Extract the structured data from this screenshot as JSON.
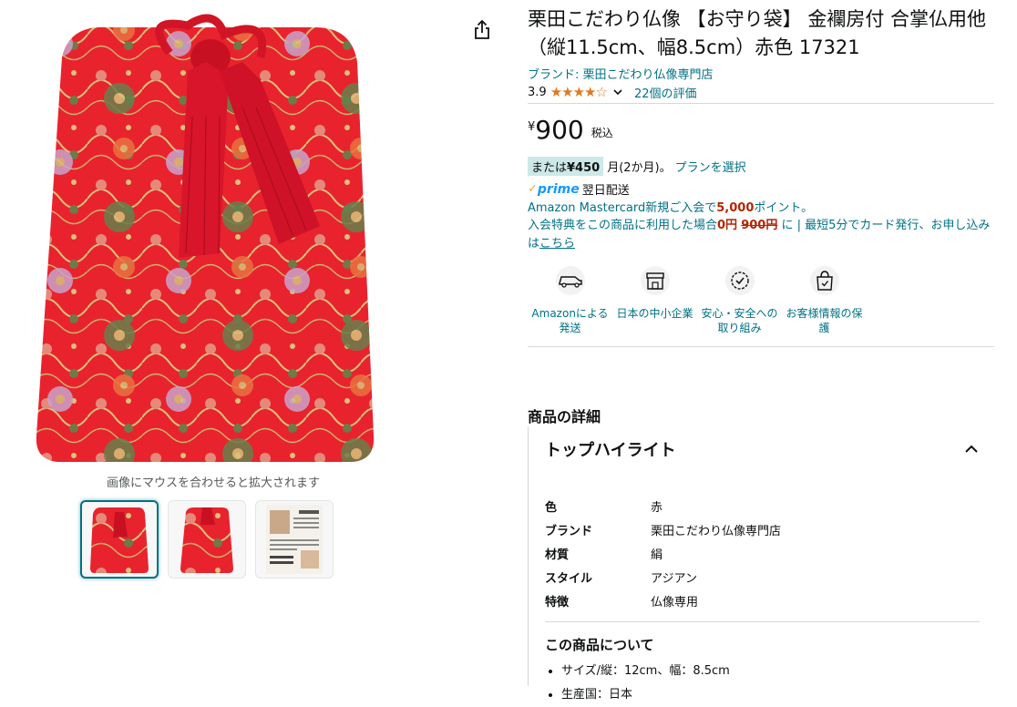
{
  "gallery": {
    "zoom_hint": "画像にマウスを合わせると拡大されます",
    "thumbnails": [
      "main-product",
      "product-angle",
      "newspaper-article"
    ],
    "selected_index": 0
  },
  "product": {
    "title": "栗田こだわり仏像 【お守り袋】 金襴房付 合掌仏用他（縦11.5cm、幅8.5cm）赤色 17321",
    "brand": "ブランド: 栗田こだわり仏像専門店",
    "rating": "3.9",
    "stars_filled": 4,
    "stars_total": 5,
    "review_count": "22個の評価"
  },
  "price": {
    "currency": "¥",
    "amount": "900",
    "tax_label": "税込"
  },
  "installment": {
    "prefix": "または",
    "amount": "¥450",
    "suffix": "月(2か月)。",
    "plan_link": "プランを選択"
  },
  "prime": {
    "check": "✓",
    "word": "prime",
    "delivery": "翌日配送"
  },
  "card_offer": {
    "line1_prefix": "Amazon Mastercard新規ご入会で",
    "line1_points": "5,000",
    "line1_suffix": "ポイント。",
    "line2_prefix": "入会特典をこの商品に利用した場合",
    "line2_zero": "0円",
    "line2_old": "900円",
    "line2_mid": " に | 最短5分でカード発行、お申し込みは",
    "line2_link": "こちら"
  },
  "features": [
    {
      "icon": "delivery-truck-icon",
      "label": "Amazonによる発送"
    },
    {
      "icon": "storefront-icon",
      "label": "日本の中小企業"
    },
    {
      "icon": "safety-badge-icon",
      "label": "安心・安全への取り組み"
    },
    {
      "icon": "secure-bag-icon",
      "label": "お客様情報の保護"
    }
  ],
  "details": {
    "section_title": "商品の詳細",
    "highlight_title": "トップハイライト",
    "specs": [
      {
        "label": "色",
        "value": "赤"
      },
      {
        "label": "ブランド",
        "value": "栗田こだわり仏像専門店"
      },
      {
        "label": "材質",
        "value": "絹"
      },
      {
        "label": "スタイル",
        "value": "アジアン"
      },
      {
        "label": "特徴",
        "value": "仏像専用"
      }
    ],
    "about_title": "この商品について",
    "about_items": [
      "サイズ/縦：12cm、幅：8.5cm",
      "生産国：日本"
    ]
  },
  "colors": {
    "link": "#007185",
    "price_red": "#b12704",
    "star": "#de7921",
    "prime_blue": "#1399ff",
    "installment_bg": "#cde8e8",
    "pouch_red": "#e8232e"
  }
}
